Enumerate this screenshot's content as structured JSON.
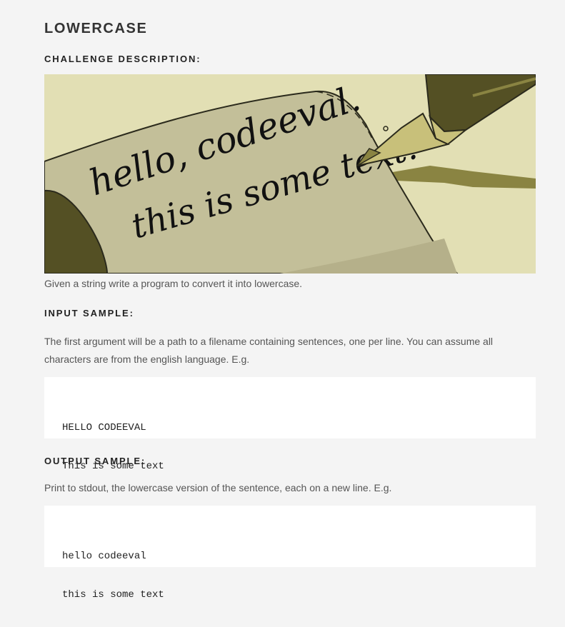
{
  "page": {
    "title": "LOWERCASE"
  },
  "description": {
    "heading": "CHALLENGE DESCRIPTION:",
    "hero_text_line1": "hello, codeeval.",
    "hero_text_line2": "this is some text.",
    "text": "Given a string write a program to convert it into lowercase."
  },
  "input_sample": {
    "heading": "INPUT SAMPLE:",
    "text": "The first argument will be a path to a filename containing sentences, one per line. You can assume all characters are from the english language. E.g.",
    "code_lines": [
      "HELLO CODEEVAL",
      "This is some text"
    ]
  },
  "output_sample": {
    "heading": "OUTPUT SAMPLE:",
    "text": "Print to stdout, the lowercase version of the sentence, each on a new line. E.g.",
    "code_lines": [
      "hello codeeval",
      "this is some text"
    ]
  },
  "colors": {
    "background": "#f4f4f4",
    "hero_background": "#e2dfb4",
    "paper": "#c3bf99",
    "pen_dark": "#545024",
    "pen_gold": "#c8c07a"
  }
}
